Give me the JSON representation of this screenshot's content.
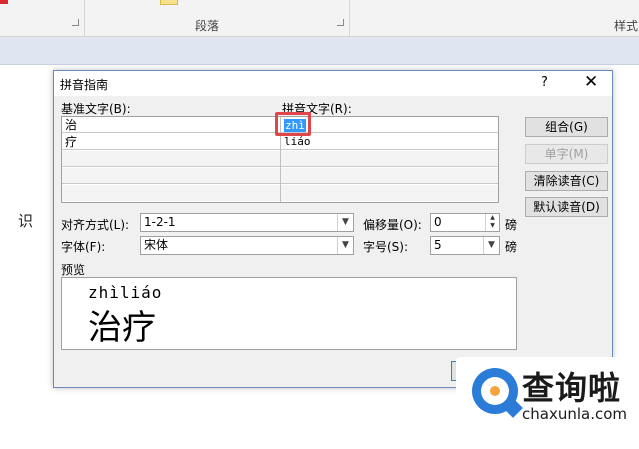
{
  "ribbon": {
    "paragraph_group": "段落",
    "styles_group": "样式"
  },
  "document": {
    "visible_char": "识"
  },
  "dialog": {
    "title": "拼音指南",
    "help": "?",
    "close": "✕",
    "base_label": "基准文字(B):",
    "pinyin_label": "拼音文字(R):",
    "rows": [
      {
        "base": "治",
        "pinyin": "zhì"
      },
      {
        "base": "疗",
        "pinyin": "liáo"
      },
      {
        "base": "",
        "pinyin": ""
      },
      {
        "base": "",
        "pinyin": ""
      },
      {
        "base": "",
        "pinyin": ""
      }
    ],
    "buttons": {
      "group": "组合(G)",
      "single": "单字(M)",
      "clear": "清除读音(C)",
      "default": "默认读音(D)"
    },
    "align_label": "对齐方式(L):",
    "align_value": "1-2-1",
    "offset_label": "偏移量(O):",
    "offset_value": "0",
    "offset_unit": "磅",
    "font_label": "字体(F):",
    "font_value": "宋体",
    "size_label": "字号(S):",
    "size_value": "5",
    "size_unit": "磅",
    "preview_label": "预览",
    "preview_ruby": "zhìliáo",
    "preview_base": "治疗"
  },
  "watermark": {
    "title": "查询啦",
    "url": "chaxunla.com"
  }
}
